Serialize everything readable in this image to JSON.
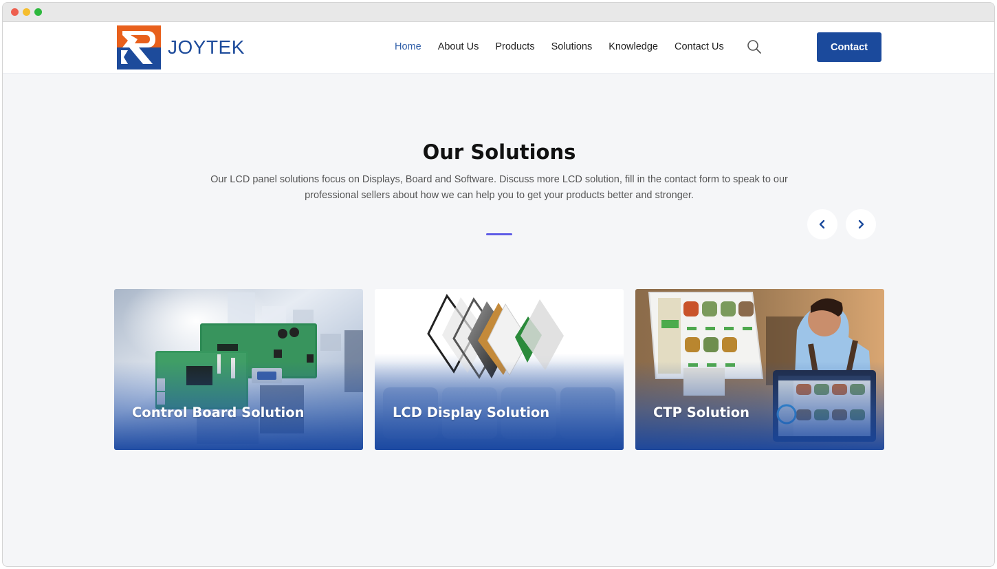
{
  "window": {
    "controls": [
      "close",
      "minimize",
      "maximize"
    ]
  },
  "header": {
    "logo_text": "JOYTEK",
    "nav": [
      {
        "label": "Home",
        "active": true
      },
      {
        "label": "About Us",
        "active": false
      },
      {
        "label": "Products",
        "active": false
      },
      {
        "label": "Solutions",
        "active": false
      },
      {
        "label": "Knowledge",
        "active": false
      },
      {
        "label": "Contact Us",
        "active": false
      }
    ],
    "search_icon": "search-icon",
    "contact_button": "Contact"
  },
  "solutions": {
    "title": "Our Solutions",
    "description": "Our LCD panel solutions focus on Displays, Board and Software. Discuss more LCD solution, fill in the contact form to speak to our professional sellers about how we can help you to get your products better and stronger.",
    "prev_icon": "chevron-left-icon",
    "next_icon": "chevron-right-icon",
    "cards": [
      {
        "title": "Control Board Solution"
      },
      {
        "title": "LCD Display Solution"
      },
      {
        "title": "CTP Solution"
      }
    ]
  },
  "colors": {
    "brand_blue": "#1b4a9c",
    "brand_orange": "#e8601c",
    "nav_active": "#2f5ea8",
    "underline_accent": "#5e5ce6",
    "page_bg": "#f5f6f8"
  }
}
